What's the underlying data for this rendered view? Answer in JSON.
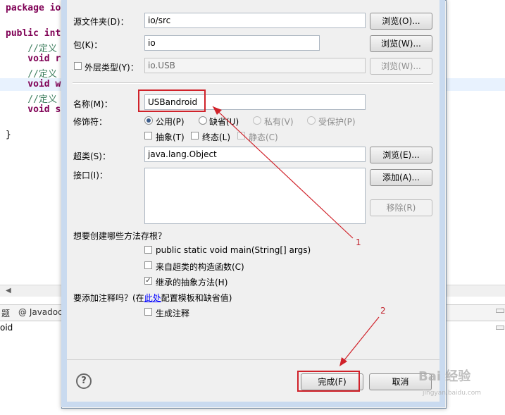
{
  "editor": {
    "line1": "package io",
    "line2a": "public",
    "line2b": " int",
    "line3": "    //定义",
    "line4": "    void r",
    "line5": "    //定义",
    "line6": "    void w",
    "line7": "    //定义",
    "line8": "    void s",
    "line9": "}"
  },
  "bottom_panel": {
    "javadoc_tab": "@ Javadoc",
    "text": "oid"
  },
  "dialog": {
    "source_folder_label": "源文件夹(D)：",
    "source_folder_value": "io/src",
    "browse_source_label": "浏览(O)...",
    "package_label": "包(K)：",
    "package_value": "io",
    "browse_package_label": "浏览(W)...",
    "enclosing_type_label": "外层类型(Y)：",
    "enclosing_type_value": "io.USB",
    "browse_enclosing_label": "浏览(W)...",
    "name_label": "名称(M)：",
    "name_value": "USBandroid",
    "modifiers_label": "修饰符：",
    "mod_public": "公用(P)",
    "mod_default": "缺省(U)",
    "mod_private": "私有(V)",
    "mod_protected": "受保护(P)",
    "mod_abstract": "抽象(T)",
    "mod_final": "终态(L)",
    "mod_static": "静态(C)",
    "superclass_label": "超类(S)：",
    "superclass_value": "java.lang.Object",
    "browse_super_label": "浏览(E)...",
    "interfaces_label": "接口(I)：",
    "add_label": "添加(A)...",
    "remove_label": "移除(R)",
    "stubs_question": "想要创建哪些方法存根？",
    "stub_main": "public static void main(String[] args)",
    "stub_constructors": "来自超类的构造函数(C)",
    "stub_inherited": "继承的抽象方法(H)",
    "comments_question_pre": "要添加注释吗？(在",
    "comments_link": "此处",
    "comments_question_post": "配置模板和缺省值)",
    "generate_comments": "生成注释",
    "help_glyph": "?",
    "finish_label": "完成(F)",
    "cancel_label": "取消"
  },
  "annotations": {
    "marker1": "1",
    "marker2": "2"
  },
  "watermark": {
    "text": "Bai 经验",
    "sub": "jingyan.baidu.com"
  },
  "colors": {
    "highlight_red": "#d0222a",
    "keyword": "#7f0055",
    "comment": "#3f7f5f"
  }
}
